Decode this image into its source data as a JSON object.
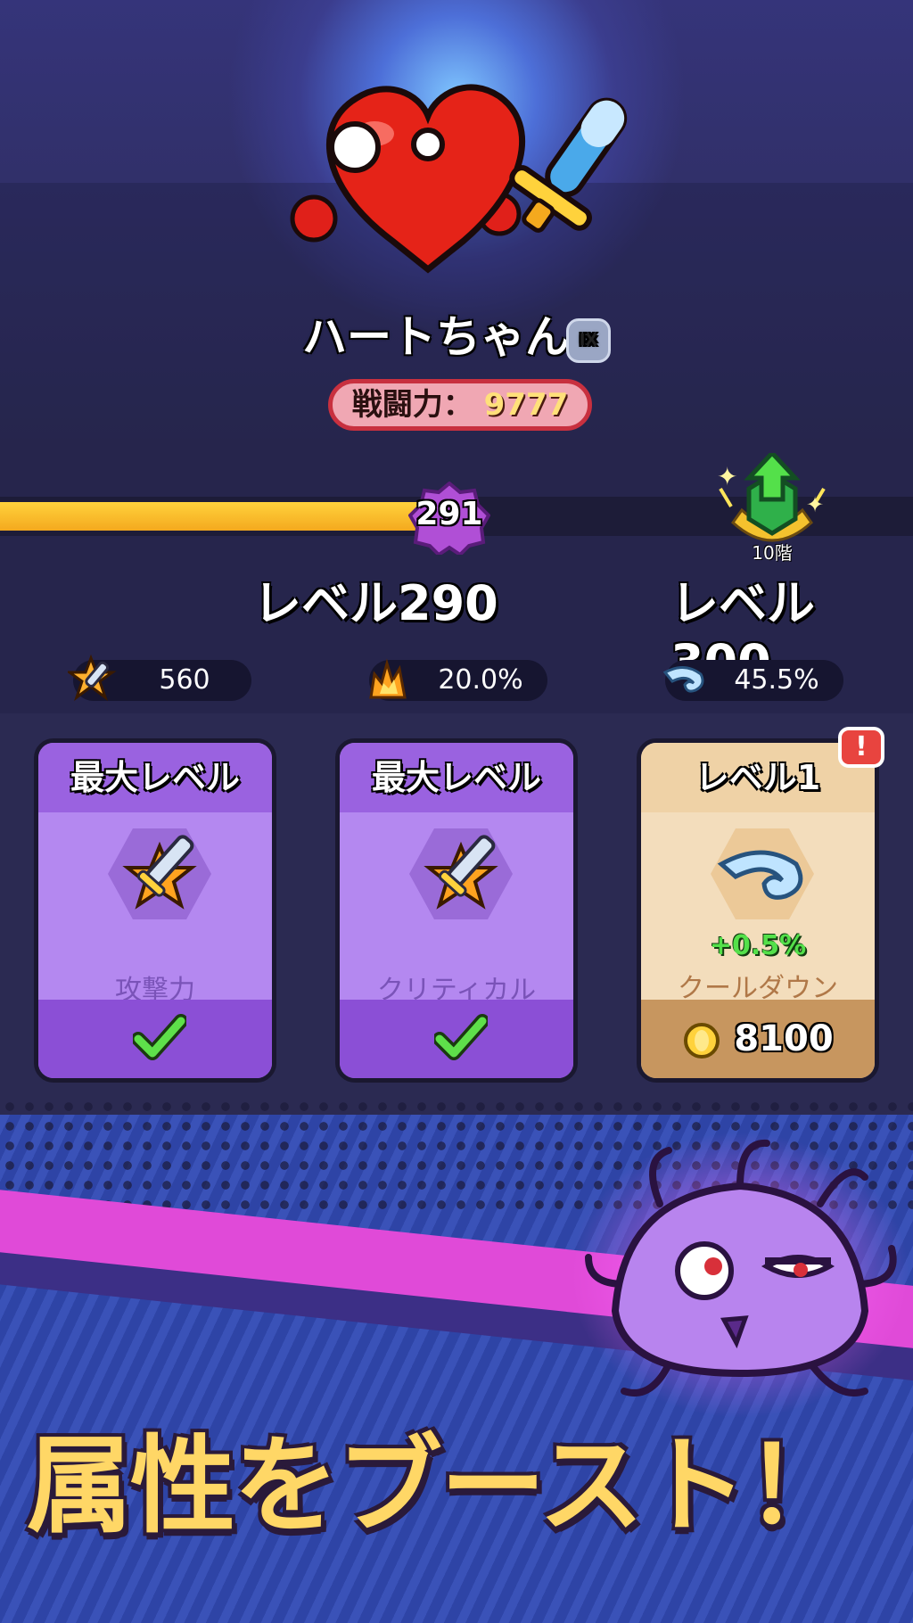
{
  "character": {
    "name": "ハートちゃん",
    "rank_badge": "IX",
    "combat_power_label": "戦闘力：",
    "combat_power_value": "9777"
  },
  "progress": {
    "current_level_marker": "291",
    "current_level_label": "レベル290",
    "next_level_label": "レベル300",
    "floor_label": "10階",
    "fill_fraction": 0.48
  },
  "stats": [
    {
      "icon": "sword-star-icon",
      "value": "560"
    },
    {
      "icon": "crit-burst-icon",
      "value": "20.0%"
    },
    {
      "icon": "wing-icon",
      "value": "45.5%"
    }
  ],
  "cards": [
    {
      "header": "最大レベル",
      "icon": "sword-star-icon",
      "name": "攻撃力",
      "status": "maxed"
    },
    {
      "header": "最大レベル",
      "icon": "sword-star-icon",
      "name": "クリティカル",
      "status": "maxed"
    },
    {
      "header": "レベル1",
      "icon": "wing-icon",
      "name": "クールダウン",
      "boost": "+0.5%",
      "price": "8100",
      "alert": "!"
    }
  ],
  "promo": {
    "slogan": "属性をブースト！"
  },
  "colors": {
    "progress_fill": "#ffc52e",
    "card_purple": "#b488f0",
    "card_tan": "#f3ddbc",
    "power_border": "#c8303f",
    "boost_green": "#54e04a"
  }
}
